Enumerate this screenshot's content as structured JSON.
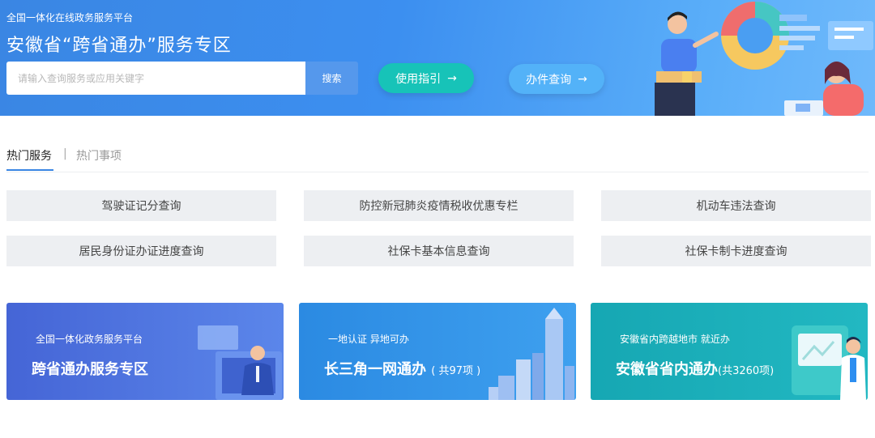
{
  "banner": {
    "subtitle": "全国一体化在线政务服务平台",
    "title": "安徽省“跨省通办”服务专区",
    "search_placeholder": "请输入查询服务或应用关键字",
    "search_button": "搜索",
    "guide_button": "使用指引",
    "query_button": "办件查询"
  },
  "tabs": {
    "active": "热门服务",
    "separator": "|",
    "inactive": "热门事项"
  },
  "services": [
    "驾驶证记分查询",
    "防控新冠肺炎疫情税收优惠专栏",
    "机动车违法查询",
    "居民身份证办证进度查询",
    "社保卡基本信息查询",
    "社保卡制卡进度查询"
  ],
  "cards": [
    {
      "subtitle": "全国一体化政务服务平台",
      "title": "跨省通办服务专区",
      "count": "",
      "color": "#4a6fd8"
    },
    {
      "subtitle": "一地认证 异地可办",
      "title": "长三角一网通办",
      "count": "( 共97项 )",
      "color": "#2f8ee2"
    },
    {
      "subtitle": "安徽省内跨越地市 就近办",
      "title": "安徽省省内通办",
      "count": "(共3260项)",
      "color": "#1aa9b5"
    }
  ],
  "icons": {
    "arrow": "→"
  }
}
